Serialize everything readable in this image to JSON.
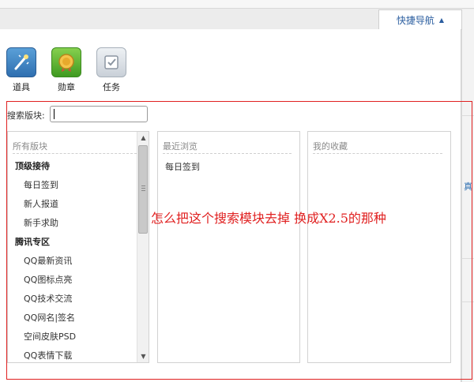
{
  "header": {
    "quick_nav_label": "快捷导航"
  },
  "toolbar": {
    "items": [
      {
        "label": "道具",
        "icon": "magic-wand-icon"
      },
      {
        "label": "勋章",
        "icon": "medal-icon"
      },
      {
        "label": "任务",
        "icon": "task-check-icon"
      }
    ]
  },
  "search": {
    "label": "搜索版块:",
    "value": ""
  },
  "columns": {
    "all": {
      "title": "所有版块",
      "groups": [
        {
          "label": "顶级接待",
          "items": [
            "每日签到",
            "新人报道",
            "新手求助"
          ]
        },
        {
          "label": "腾讯专区",
          "items": [
            "QQ最新资讯",
            "QQ图标点亮",
            "QQ技术交流",
            "QQ网名|签名",
            "空间皮肤PSD",
            "QQ表情下载"
          ]
        }
      ]
    },
    "recent": {
      "title": "最近浏览",
      "items": [
        "每日签到"
      ]
    },
    "favorites": {
      "title": "我的收藏"
    }
  },
  "annotation": {
    "text": "怎么把这个搜索模块去掉  换成X2.5的那种"
  },
  "background": {
    "right_mark": "真"
  },
  "colors": {
    "link": "#2a5d9f",
    "annotation_red": "#e02020"
  }
}
